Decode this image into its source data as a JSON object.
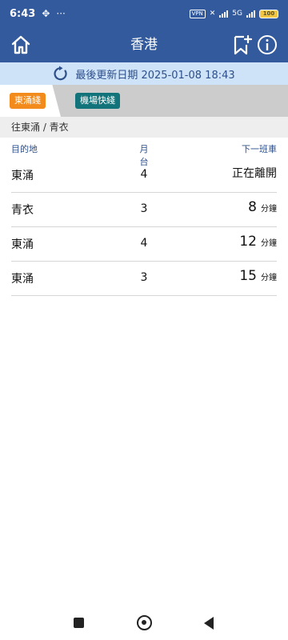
{
  "status_bar": {
    "time": "6:43",
    "left_icons": [
      "crosshair-icon",
      "more-icon"
    ],
    "vpn_label": "VPN",
    "network_label": "5G",
    "battery_level": "100",
    "colors": {
      "background": "#335a9c",
      "battery": "#f4c542"
    }
  },
  "app_bar": {
    "title": "香港",
    "icons": [
      "home-icon",
      "bookmark-add-icon",
      "info-icon"
    ],
    "background": "#335a9c"
  },
  "update_bar": {
    "text": "最後更新日期 2025-01-08 18:43",
    "icon": "refresh-icon",
    "background": "#cfe3f8"
  },
  "line_tabs": [
    {
      "label": "東涌綫",
      "selected": true,
      "color": "#f38b1c"
    },
    {
      "label": "機場快綫",
      "selected": false,
      "color": "#12747a"
    }
  ],
  "direction": "往東涌 / 青衣",
  "table": {
    "headers": {
      "destination": "目的地",
      "platform": "月台",
      "next_train": "下一班車"
    },
    "rows": [
      {
        "destination": "東涌",
        "platform": "4",
        "next_text": "正在離開",
        "minutes": "",
        "unit": ""
      },
      {
        "destination": "青衣",
        "platform": "3",
        "next_text": "",
        "minutes": "8",
        "unit": "分鐘"
      },
      {
        "destination": "東涌",
        "platform": "4",
        "next_text": "",
        "minutes": "12",
        "unit": "分鐘"
      },
      {
        "destination": "東涌",
        "platform": "3",
        "next_text": "",
        "minutes": "15",
        "unit": "分鐘"
      }
    ]
  },
  "nav_bar": {
    "icons": [
      "recent-apps-icon",
      "home-circle-icon",
      "back-icon"
    ]
  }
}
